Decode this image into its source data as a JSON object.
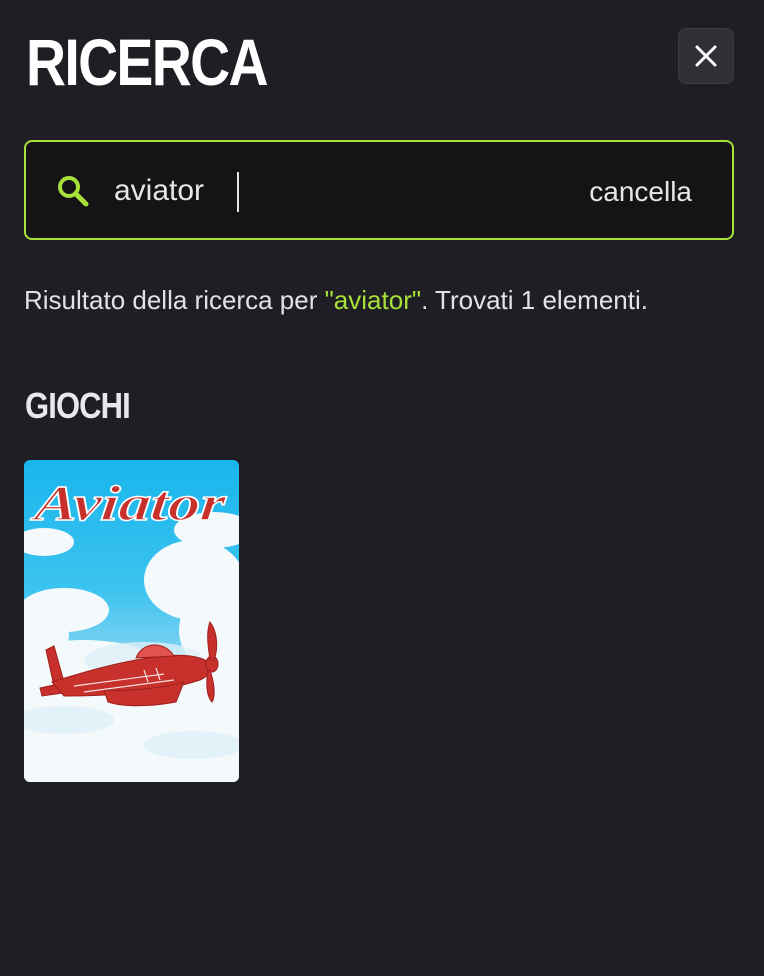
{
  "header": {
    "title": "RICERCA",
    "close_icon": "close-icon"
  },
  "search": {
    "icon": "search-icon",
    "value": "aviator",
    "clear_label": "cancella",
    "accent_color": "#a8e03a"
  },
  "results": {
    "prefix": "Risultato della ricerca per ",
    "query_display": "\"aviator\"",
    "suffix": ". Trovati 1 elementi."
  },
  "games_section": {
    "title": "GIOCHI",
    "items": [
      {
        "logo_text": "Aviator"
      }
    ]
  }
}
